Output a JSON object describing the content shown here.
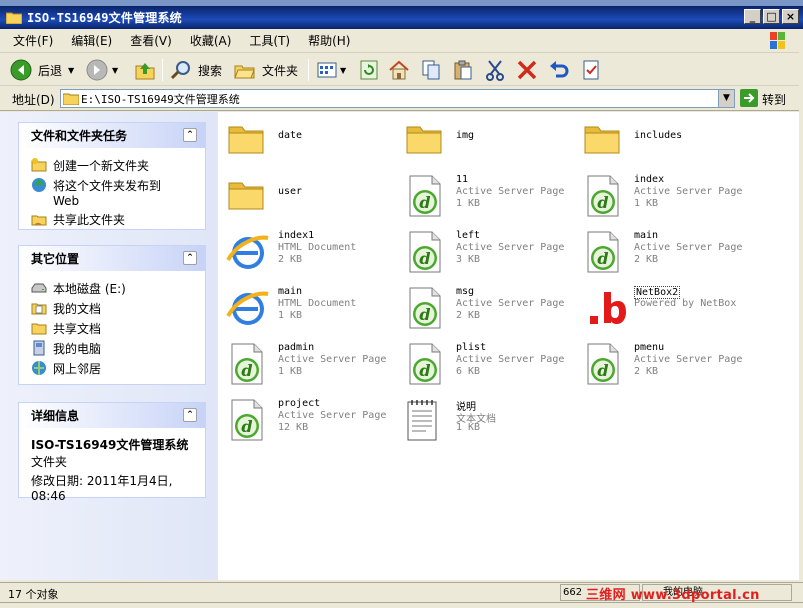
{
  "window": {
    "title": "ISO-TS16949文件管理系统",
    "buttons": [
      "_",
      "□",
      "×"
    ]
  },
  "menubar": {
    "items": [
      "文件(F)",
      "编辑(E)",
      "查看(V)",
      "收藏(A)",
      "工具(T)",
      "帮助(H)"
    ]
  },
  "toolbar": {
    "back_label": "后退",
    "search_label": "搜索",
    "folders_label": "文件夹"
  },
  "addressbar": {
    "label": "地址(D)",
    "value": "E:\\ISO-TS16949文件管理系统",
    "go_label": "转到"
  },
  "tasks_panel": {
    "title": "文件和文件夹任务",
    "items": [
      {
        "label": "创建一个新文件夹",
        "icon": "new-folder-icon"
      },
      {
        "label": "将这个文件夹发布到 Web",
        "icon": "publish-web-icon"
      },
      {
        "label": "共享此文件夹",
        "icon": "share-folder-icon"
      }
    ]
  },
  "places_panel": {
    "title": "其它位置",
    "items": [
      {
        "label": "本地磁盘 (E:)",
        "icon": "drive-icon"
      },
      {
        "label": "我的文档",
        "icon": "my-documents-icon"
      },
      {
        "label": "共享文档",
        "icon": "shared-documents-icon"
      },
      {
        "label": "我的电脑",
        "icon": "my-computer-icon"
      },
      {
        "label": "网上邻居",
        "icon": "network-places-icon"
      }
    ]
  },
  "details_panel": {
    "title": "详细信息",
    "name": "ISO-TS16949文件管理系统",
    "kind": "文件夹",
    "modified": "修改日期: 2011年1月4日, 08:46"
  },
  "files": [
    {
      "name": "date",
      "type": "",
      "size": "",
      "icon": "folder-icon"
    },
    {
      "name": "img",
      "type": "",
      "size": "",
      "icon": "folder-icon"
    },
    {
      "name": "includes",
      "type": "",
      "size": "",
      "icon": "folder-icon"
    },
    {
      "name": "user",
      "type": "",
      "size": "",
      "icon": "folder-icon"
    },
    {
      "name": "11",
      "type": "Active Server Page",
      "size": "1 KB",
      "icon": "asp-file-icon"
    },
    {
      "name": "index",
      "type": "Active Server Page",
      "size": "1 KB",
      "icon": "asp-file-icon"
    },
    {
      "name": "index1",
      "type": "HTML Document",
      "size": "2 KB",
      "icon": "html-file-icon"
    },
    {
      "name": "left",
      "type": "Active Server Page",
      "size": "3 KB",
      "icon": "asp-file-icon"
    },
    {
      "name": "main",
      "type": "Active Server Page",
      "size": "2 KB",
      "icon": "asp-file-icon"
    },
    {
      "name": "main",
      "type": "HTML Document",
      "size": "1 KB",
      "icon": "html-file-icon"
    },
    {
      "name": "msg",
      "type": "Active Server Page",
      "size": "2 KB",
      "icon": "asp-file-icon"
    },
    {
      "name": "NetBox2",
      "type": "Powered by NetBox",
      "size": "",
      "icon": "netbox-icon"
    },
    {
      "name": "padmin",
      "type": "Active Server Page",
      "size": "1 KB",
      "icon": "asp-file-icon"
    },
    {
      "name": "plist",
      "type": "Active Server Page",
      "size": "6 KB",
      "icon": "asp-file-icon"
    },
    {
      "name": "pmenu",
      "type": "Active Server Page",
      "size": "2 KB",
      "icon": "asp-file-icon"
    },
    {
      "name": "project",
      "type": "Active Server Page",
      "size": "12 KB",
      "icon": "asp-file-icon"
    },
    {
      "name": "说明",
      "type": "文本文档",
      "size": "1 KB",
      "icon": "text-file-icon"
    }
  ],
  "statusbar": {
    "objects": "17 个对象",
    "size": "662",
    "location": "我的电脑"
  },
  "watermark": "三维网 www.3dportal.cn"
}
